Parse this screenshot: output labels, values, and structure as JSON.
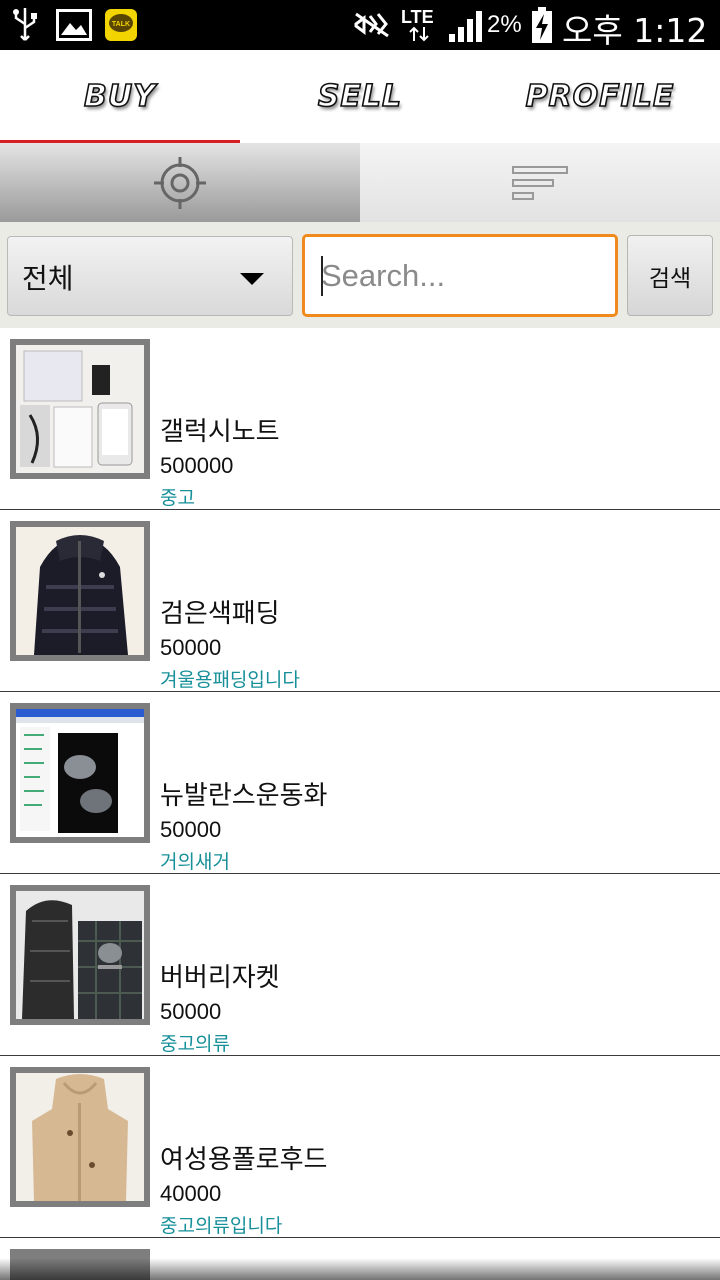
{
  "status_bar": {
    "network": "LTE",
    "battery": "2%",
    "time": "오후 1:12",
    "icons": [
      "usb-icon",
      "gallery-icon",
      "kakaotalk-icon",
      "no-sound-icon",
      "signal-icon",
      "battery-charging-icon"
    ],
    "talk_label": "TALK"
  },
  "tabs": [
    {
      "label": "BUY",
      "selected": true
    },
    {
      "label": "SELL",
      "selected": false
    },
    {
      "label": "PROFILE",
      "selected": false
    }
  ],
  "accent_color": "#d71f26",
  "mode_toggle": {
    "left_icon": "location-target-icon",
    "right_icon": "list-sort-icon",
    "active": "left"
  },
  "filter": {
    "category": "전체",
    "search_placeholder": "Search...",
    "search_button": "검색",
    "search_focus_color": "#f08a1c"
  },
  "items": [
    {
      "title": "갤럭시노트",
      "price": "500000",
      "desc": "중고"
    },
    {
      "title": "검은색패딩",
      "price": "50000",
      "desc": "겨울용패딩입니다"
    },
    {
      "title": "뉴발란스운동화",
      "price": "50000",
      "desc": "거의새거"
    },
    {
      "title": "버버리자켓",
      "price": "50000",
      "desc": "중고의류"
    },
    {
      "title": "여성용폴로후드",
      "price": "40000",
      "desc": "중고의류입니다"
    }
  ],
  "desc_color": "#17909a"
}
